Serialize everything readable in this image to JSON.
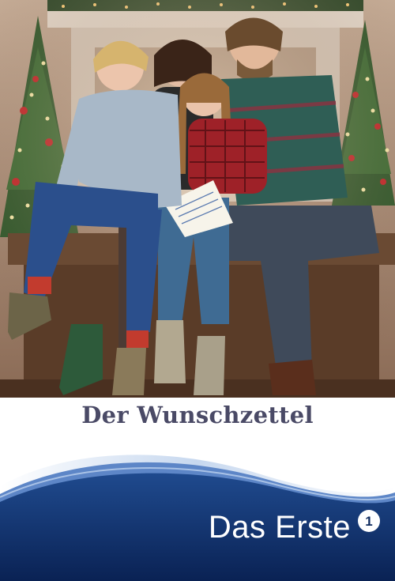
{
  "movie": {
    "title": "Der Wunschzettel"
  },
  "channel": {
    "name": "Das Erste",
    "logo_icon": "ard-one-logo-icon",
    "logo_label": "1"
  },
  "colors": {
    "title_text": "#4a4a66",
    "band_dark": "#0e2a5e",
    "band_mid": "#2f5aa8",
    "band_light": "#dfe9f6"
  }
}
